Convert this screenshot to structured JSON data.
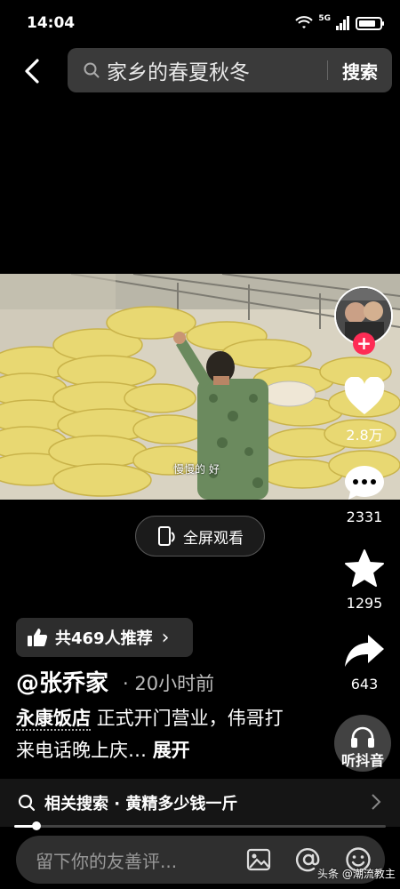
{
  "status_bar": {
    "time": "14:04",
    "network": "5G",
    "battery_level": 0.8
  },
  "header": {
    "back_icon": "chevron-left-icon",
    "search_query": "家乡的春夏秋冬",
    "search_button": "搜索"
  },
  "video": {
    "caption": "慢慢的   好"
  },
  "fullscreen_button": "全屏观看",
  "sidebar": {
    "follow_symbol": "+",
    "likes": "2.8万",
    "comments": "2331",
    "favorites": "1295",
    "shares": "643",
    "listen_label": "听抖音"
  },
  "recommend": {
    "label": "共469人推荐",
    "chevron": "›"
  },
  "post": {
    "author": "@张乔家",
    "time_ago": "· 20小时前",
    "highlight": "永康饭店",
    "text": " 正式开门营业，伟哥打来电话晚上庆…",
    "expand": "展开"
  },
  "related_search": {
    "prefix": "相关搜索 · ",
    "query": "黄精多少钱一斤"
  },
  "progress": {
    "fraction": 0.06
  },
  "comment_bar": {
    "placeholder": "留下你的友善评..."
  },
  "watermark": "头条 @潮流教主",
  "colors": {
    "follow_red": "#fe2c55",
    "background": "#000000",
    "sack_yellow": "#e6d46a"
  }
}
